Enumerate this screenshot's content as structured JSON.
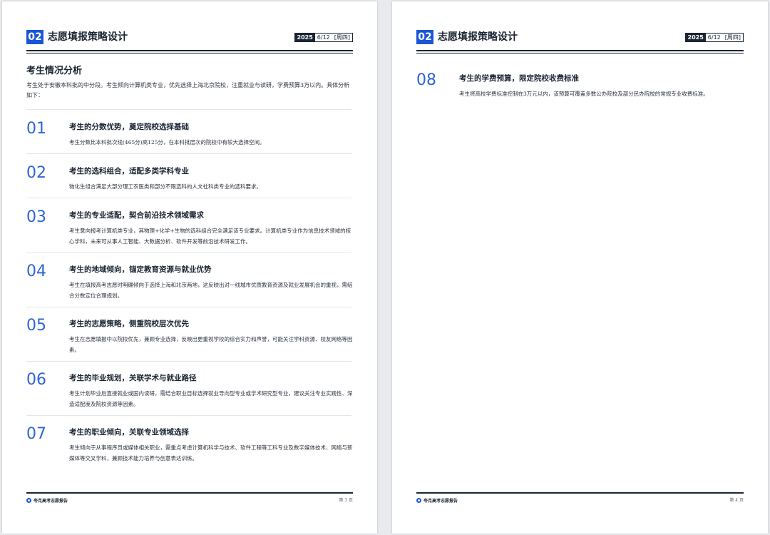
{
  "header": {
    "chapter_num": "02",
    "chapter_title": "志愿填报策略设计",
    "year": "2025",
    "month_day": "6/12",
    "weekday": "[周四]"
  },
  "footer": {
    "brand": "夸克高考志愿报告"
  },
  "pages": [
    {
      "page_label": "第 3 页",
      "section_title": "考生情况分析",
      "intro": "考生处于安徽本科批的中分段。考生倾向计算机类专业，优先选择上海北京院校，注重就业与读研，学费预算3万以内。具体分析如下：",
      "items": [
        {
          "num": "01",
          "title": "考生的分数优势，奠定院校选择基础",
          "desc": "考生分数比本科批次线(465分)高125分，在本科批层次的院校中有较大选择空间。"
        },
        {
          "num": "02",
          "title": "考生的选科组合，适配多类学科专业",
          "desc": "物化生组合满足大部分理工农医类和部分不限选科的人文社科类专业的选科要求。"
        },
        {
          "num": "03",
          "title": "考生的专业适配，契合前沿技术领域需求",
          "desc": "考生意向报考计算机类专业，其物理+化学+生物的选科组合完全满足该专业要求。计算机类专业作为信息技术领域的核心学科，未来可从事人工智能、大数据分析、软件开发等前沿技术研发工作。"
        },
        {
          "num": "04",
          "title": "考生的地域倾向，锚定教育资源与就业优势",
          "desc": "考生在填报高考志愿时明确倾向于选择上海和北京两地，这反映出对一线城市优质教育资源及就业发展机会的重视，需结合分数定位合理规划。"
        },
        {
          "num": "05",
          "title": "考生的志愿策略，侧重院校层次优先",
          "desc": "考生在志愿填报中以院校优先，兼顾专业选择，反映出更重视学校的综合实力和声誉，可能关注学科资源、校友网络等因素。"
        },
        {
          "num": "06",
          "title": "考生的毕业规划，关联学术与就业路径",
          "desc": "考生计划毕业后直接就业或国内读研，需结合职业目标选择就业导向型专业或学术研究型专业，建议关注专业实践性、深造适配度及院校资源等因素。"
        },
        {
          "num": "07",
          "title": "考生的职业倾向，关联专业领域选择",
          "desc": "考生倾向于从事程序员或媒体相关职业，需重点考虑计算机科学与技术、软件工程等工科专业及数字媒体技术、网络与新媒体等交叉学科，兼顾技术能力培养与创意表达训练。"
        }
      ]
    },
    {
      "page_label": "第 4 页",
      "items": [
        {
          "num": "08",
          "title": "考生的学费预算，限定院校收费标准",
          "desc": "考生将高校学费标准控制在3万元以内，该预算可覆盖多数公办院校及部分民办院校的常规专业收费标准。"
        }
      ]
    }
  ]
}
